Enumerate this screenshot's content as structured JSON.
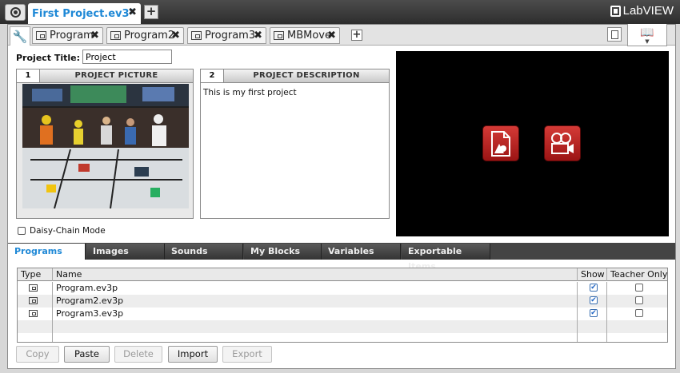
{
  "topbar": {
    "project_tab": "First Project.ev3*",
    "close": "✖",
    "plus": "+",
    "brand": "LabVIEW"
  },
  "program_tabs": [
    {
      "label": "Program"
    },
    {
      "label": "Program2"
    },
    {
      "label": "Program3"
    },
    {
      "label": "MBMove"
    }
  ],
  "tab_close": "✖",
  "tab_plus": "+",
  "project": {
    "title_label": "Project Title:",
    "title_value": "Project",
    "picture_num": "1",
    "picture_title": "PROJECT PICTURE",
    "desc_num": "2",
    "desc_title": "PROJECT DESCRIPTION",
    "description": "This is my first project",
    "daisy_chain": "Daisy-Chain Mode"
  },
  "bottom_tabs": [
    "Programs",
    "Images",
    "Sounds",
    "My Blocks",
    "Variables",
    "Exportable Items"
  ],
  "table": {
    "headers": {
      "type": "Type",
      "name": "Name",
      "show": "Show",
      "teacher": "Teacher Only"
    },
    "rows": [
      {
        "name": "Program.ev3p",
        "show": true,
        "teacher": false
      },
      {
        "name": "Program2.ev3p",
        "show": true,
        "teacher": false
      },
      {
        "name": "Program3.ev3p",
        "show": true,
        "teacher": false
      }
    ]
  },
  "actions": {
    "copy": "Copy",
    "paste": "Paste",
    "delete": "Delete",
    "import": "Import",
    "export": "Export"
  },
  "colors": {
    "accent": "#1e88d6",
    "media_button": "#c62828"
  }
}
